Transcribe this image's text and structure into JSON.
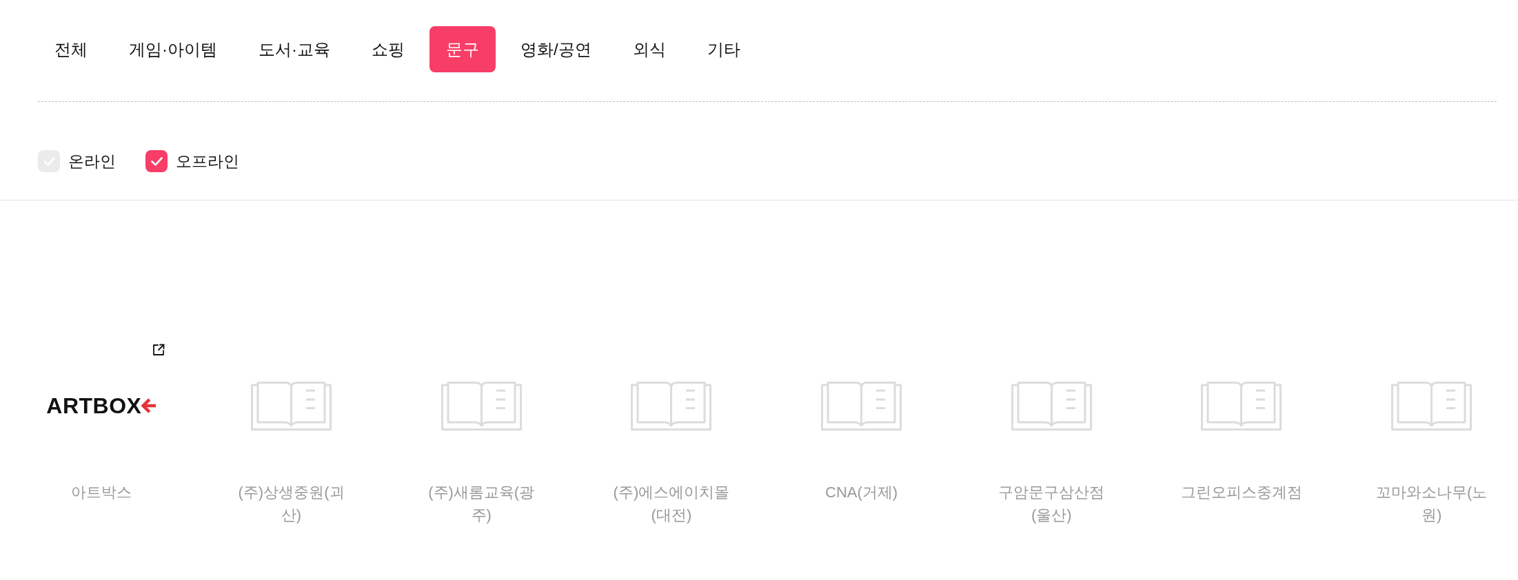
{
  "tabs": [
    {
      "label": "전체",
      "selected": false
    },
    {
      "label": "게임·아이템",
      "selected": false
    },
    {
      "label": "도서·교육",
      "selected": false
    },
    {
      "label": "쇼핑",
      "selected": false
    },
    {
      "label": "문구",
      "selected": true
    },
    {
      "label": "영화/공연",
      "selected": false
    },
    {
      "label": "외식",
      "selected": false
    },
    {
      "label": "기타",
      "selected": false
    }
  ],
  "filters": [
    {
      "label": "온라인",
      "checked": false
    },
    {
      "label": "오프라인",
      "checked": true
    }
  ],
  "stores": [
    {
      "kind": "logo",
      "logo_text": "ARTBOX",
      "external_link": true,
      "name": "아트박스"
    },
    {
      "kind": "placeholder",
      "external_link": false,
      "name": "(주)상생중원(괴산)"
    },
    {
      "kind": "placeholder",
      "external_link": false,
      "name": "(주)새롬교육(광주)"
    },
    {
      "kind": "placeholder",
      "external_link": false,
      "name": "(주)에스에이치몰(대전)"
    },
    {
      "kind": "placeholder",
      "external_link": false,
      "name": "CNA(거제)"
    },
    {
      "kind": "placeholder",
      "external_link": false,
      "name": "구암문구삼산점(울산)"
    },
    {
      "kind": "placeholder",
      "external_link": false,
      "name": "그린오피스중계점"
    },
    {
      "kind": "placeholder",
      "external_link": false,
      "name": "꼬마와소나무(노원)"
    }
  ]
}
